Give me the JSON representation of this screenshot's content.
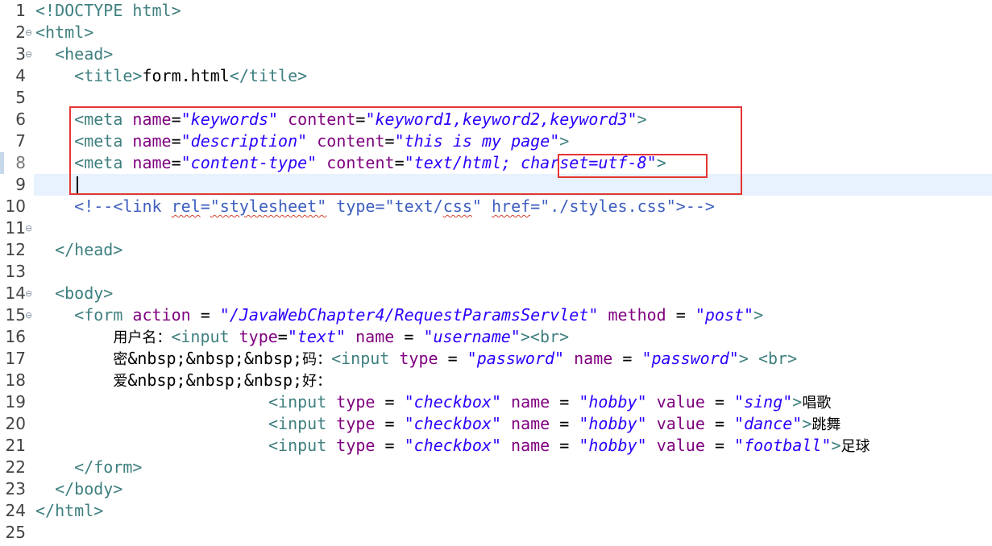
{
  "editor": {
    "language": "HTML",
    "current_line": 9,
    "colors": {
      "tag": "#3f7f7f",
      "attribute": "#7f007f",
      "string": "#2a00ff",
      "comment": "#3f5fbf",
      "current_line_bg": "#e8f2fe",
      "highlight_box": "#e53535"
    }
  },
  "lines": [
    {
      "number": "1",
      "fold": "",
      "tokens": [
        {
          "t": "tag",
          "v": "<!DOCTYPE html>"
        }
      ]
    },
    {
      "number": "2",
      "fold": "⊖",
      "tokens": [
        {
          "t": "tag",
          "v": "<html>"
        }
      ]
    },
    {
      "number": "3",
      "fold": "⊖",
      "tokens": [
        {
          "t": "text",
          "v": "  "
        },
        {
          "t": "tag",
          "v": "<head>"
        }
      ]
    },
    {
      "number": "4",
      "fold": "",
      "tokens": [
        {
          "t": "text",
          "v": "    "
        },
        {
          "t": "tag",
          "v": "<title>"
        },
        {
          "t": "text",
          "v": "form.html"
        },
        {
          "t": "tag",
          "v": "</title>"
        }
      ]
    },
    {
      "number": "5",
      "fold": "",
      "tokens": []
    },
    {
      "number": "6",
      "fold": "",
      "tokens": [
        {
          "t": "text",
          "v": "    "
        },
        {
          "t": "tag",
          "v": "<meta "
        },
        {
          "t": "attr",
          "v": "name"
        },
        {
          "t": "text",
          "v": "="
        },
        {
          "t": "str",
          "v": "\"keywords\""
        },
        {
          "t": "text",
          "v": " "
        },
        {
          "t": "attr",
          "v": "content"
        },
        {
          "t": "text",
          "v": "="
        },
        {
          "t": "str",
          "v": "\"keyword1,keyword2,keyword3\""
        },
        {
          "t": "tag",
          "v": ">"
        }
      ]
    },
    {
      "number": "7",
      "fold": "",
      "tokens": [
        {
          "t": "text",
          "v": "    "
        },
        {
          "t": "tag",
          "v": "<meta "
        },
        {
          "t": "attr",
          "v": "name"
        },
        {
          "t": "text",
          "v": "="
        },
        {
          "t": "str",
          "v": "\"description\""
        },
        {
          "t": "text",
          "v": " "
        },
        {
          "t": "attr",
          "v": "content"
        },
        {
          "t": "text",
          "v": "="
        },
        {
          "t": "str",
          "v": "\"this is my page\""
        },
        {
          "t": "tag",
          "v": ">"
        }
      ]
    },
    {
      "number": "8",
      "fold": "",
      "tokens": [
        {
          "t": "text",
          "v": "    "
        },
        {
          "t": "tag",
          "v": "<meta "
        },
        {
          "t": "attr",
          "v": "name"
        },
        {
          "t": "text",
          "v": "="
        },
        {
          "t": "str",
          "v": "\"content-type\""
        },
        {
          "t": "text",
          "v": " "
        },
        {
          "t": "attr",
          "v": "content"
        },
        {
          "t": "text",
          "v": "="
        },
        {
          "t": "str",
          "v": "\"text/html; charset=utf-8\""
        },
        {
          "t": "tag",
          "v": ">"
        }
      ]
    },
    {
      "number": "9",
      "fold": "",
      "tokens": []
    },
    {
      "number": "10",
      "fold": "",
      "tokens": [
        {
          "t": "text",
          "v": "    "
        },
        {
          "t": "comment",
          "v": "<!--<link "
        },
        {
          "t": "comment-sq",
          "v": "rel"
        },
        {
          "t": "comment",
          "v": "="
        },
        {
          "t": "comment-sq",
          "v": "\"stylesheet\""
        },
        {
          "t": "comment",
          "v": " type=\"text/"
        },
        {
          "t": "comment-sq",
          "v": "css"
        },
        {
          "t": "comment",
          "v": "\" "
        },
        {
          "t": "comment-sq",
          "v": "href"
        },
        {
          "t": "comment",
          "v": "=\"./styles.css\">-->"
        }
      ]
    },
    {
      "number": "11",
      "fold": "⊖",
      "tokens": []
    },
    {
      "number": "12",
      "fold": "",
      "tokens": [
        {
          "t": "text",
          "v": "  "
        },
        {
          "t": "tag",
          "v": "</head>"
        }
      ]
    },
    {
      "number": "13",
      "fold": "",
      "tokens": []
    },
    {
      "number": "14",
      "fold": "⊖",
      "tokens": [
        {
          "t": "text",
          "v": "  "
        },
        {
          "t": "tag",
          "v": "<body>"
        }
      ]
    },
    {
      "number": "15",
      "fold": "⊖",
      "tokens": [
        {
          "t": "text",
          "v": "    "
        },
        {
          "t": "tag",
          "v": "<form "
        },
        {
          "t": "attr",
          "v": "action"
        },
        {
          "t": "text",
          "v": " = "
        },
        {
          "t": "str",
          "v": "\"/JavaWebChapter4/RequestParamsServlet\""
        },
        {
          "t": "text",
          "v": " "
        },
        {
          "t": "attr",
          "v": "method"
        },
        {
          "t": "text",
          "v": " = "
        },
        {
          "t": "str",
          "v": "\"post\""
        },
        {
          "t": "tag",
          "v": ">"
        }
      ]
    },
    {
      "number": "16",
      "fold": "",
      "tokens": [
        {
          "t": "text",
          "v": "        "
        },
        {
          "t": "cjk",
          "v": "用户名："
        },
        {
          "t": "tag",
          "v": "<input "
        },
        {
          "t": "attr",
          "v": "type"
        },
        {
          "t": "text",
          "v": "="
        },
        {
          "t": "str",
          "v": "\"text\""
        },
        {
          "t": "text",
          "v": " "
        },
        {
          "t": "attr",
          "v": "name"
        },
        {
          "t": "text",
          "v": " = "
        },
        {
          "t": "str",
          "v": "\"username\""
        },
        {
          "t": "tag",
          "v": "><br>"
        }
      ]
    },
    {
      "number": "17",
      "fold": "",
      "tokens": [
        {
          "t": "text",
          "v": "        "
        },
        {
          "t": "cjk",
          "v": "密"
        },
        {
          "t": "text",
          "v": "&nbsp;&nbsp;&nbsp;"
        },
        {
          "t": "cjk",
          "v": "码："
        },
        {
          "t": "tag",
          "v": "<input "
        },
        {
          "t": "attr",
          "v": "type"
        },
        {
          "t": "text",
          "v": " = "
        },
        {
          "t": "str",
          "v": "\"password\""
        },
        {
          "t": "text",
          "v": " "
        },
        {
          "t": "attr",
          "v": "name"
        },
        {
          "t": "text",
          "v": " = "
        },
        {
          "t": "str",
          "v": "\"password\""
        },
        {
          "t": "tag",
          "v": "> <br>"
        }
      ]
    },
    {
      "number": "18",
      "fold": "",
      "tokens": [
        {
          "t": "text",
          "v": "        "
        },
        {
          "t": "cjk",
          "v": "爱"
        },
        {
          "t": "text",
          "v": "&nbsp;&nbsp;&nbsp;"
        },
        {
          "t": "cjk",
          "v": "好："
        }
      ]
    },
    {
      "number": "19",
      "fold": "",
      "tokens": [
        {
          "t": "text",
          "v": "                        "
        },
        {
          "t": "tag",
          "v": "<input "
        },
        {
          "t": "attr",
          "v": "type"
        },
        {
          "t": "text",
          "v": " = "
        },
        {
          "t": "str",
          "v": "\"checkbox\""
        },
        {
          "t": "text",
          "v": " "
        },
        {
          "t": "attr",
          "v": "name"
        },
        {
          "t": "text",
          "v": " = "
        },
        {
          "t": "str",
          "v": "\"hobby\""
        },
        {
          "t": "text",
          "v": " "
        },
        {
          "t": "attr",
          "v": "value"
        },
        {
          "t": "text",
          "v": " = "
        },
        {
          "t": "str",
          "v": "\"sing\""
        },
        {
          "t": "tag",
          "v": ">"
        },
        {
          "t": "cjk",
          "v": "唱歌"
        }
      ]
    },
    {
      "number": "20",
      "fold": "",
      "tokens": [
        {
          "t": "text",
          "v": "                        "
        },
        {
          "t": "tag",
          "v": "<input "
        },
        {
          "t": "attr",
          "v": "type"
        },
        {
          "t": "text",
          "v": " = "
        },
        {
          "t": "str",
          "v": "\"checkbox\""
        },
        {
          "t": "text",
          "v": " "
        },
        {
          "t": "attr",
          "v": "name"
        },
        {
          "t": "text",
          "v": " = "
        },
        {
          "t": "str",
          "v": "\"hobby\""
        },
        {
          "t": "text",
          "v": " "
        },
        {
          "t": "attr",
          "v": "value"
        },
        {
          "t": "text",
          "v": " = "
        },
        {
          "t": "str",
          "v": "\"dance\""
        },
        {
          "t": "tag",
          "v": ">"
        },
        {
          "t": "cjk",
          "v": "跳舞"
        }
      ]
    },
    {
      "number": "21",
      "fold": "",
      "tokens": [
        {
          "t": "text",
          "v": "                        "
        },
        {
          "t": "tag",
          "v": "<input "
        },
        {
          "t": "attr",
          "v": "type"
        },
        {
          "t": "text",
          "v": " = "
        },
        {
          "t": "str",
          "v": "\"checkbox\""
        },
        {
          "t": "text",
          "v": " "
        },
        {
          "t": "attr",
          "v": "name"
        },
        {
          "t": "text",
          "v": " = "
        },
        {
          "t": "str",
          "v": "\"hobby\""
        },
        {
          "t": "text",
          "v": " "
        },
        {
          "t": "attr",
          "v": "value"
        },
        {
          "t": "text",
          "v": " = "
        },
        {
          "t": "str",
          "v": "\"football\""
        },
        {
          "t": "tag",
          "v": ">"
        },
        {
          "t": "cjk",
          "v": "足球"
        }
      ]
    },
    {
      "number": "22",
      "fold": "",
      "tokens": [
        {
          "t": "text",
          "v": "    "
        },
        {
          "t": "tag",
          "v": "</form>"
        }
      ]
    },
    {
      "number": "23",
      "fold": "",
      "tokens": [
        {
          "t": "text",
          "v": "  "
        },
        {
          "t": "tag",
          "v": "</body>"
        }
      ]
    },
    {
      "number": "24",
      "fold": "",
      "tokens": [
        {
          "t": "tag",
          "v": "</html>"
        }
      ]
    },
    {
      "number": "25",
      "fold": "",
      "tokens": []
    }
  ]
}
